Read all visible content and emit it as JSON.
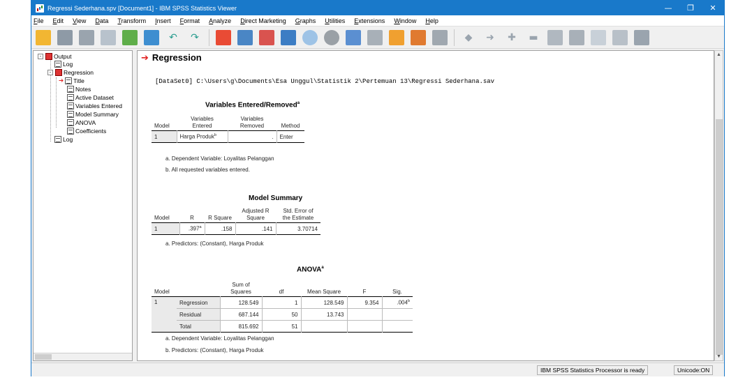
{
  "window": {
    "title": "Regressi Sederhana.spv [Document1] - IBM SPSS Statistics Viewer",
    "min": "—",
    "max": "❐",
    "close": "✕"
  },
  "menu": [
    "File",
    "Edit",
    "View",
    "Data",
    "Transform",
    "Insert",
    "Format",
    "Analyze",
    "Direct Marketing",
    "Graphs",
    "Utilities",
    "Extensions",
    "Window",
    "Help"
  ],
  "toolbar": {
    "icons": [
      "open-icon",
      "save-icon",
      "print-icon",
      "print-preview-icon",
      "export-icon",
      "recall-dialog-icon",
      "undo-icon",
      "redo-icon",
      "goto-data-icon",
      "goto-case-icon",
      "goto-variable-icon",
      "variables-icon",
      "run-descriptives-icon",
      "use-variable-sets-icon",
      "show-all-variables-icon",
      "select-cases-icon",
      "value-labels-icon",
      "designate-window-icon",
      "promote-icon",
      "demote-icon",
      "expand-icon",
      "collapse-icon",
      "show-icon",
      "hide-icon",
      "insert-heading-icon",
      "insert-title-icon",
      "insert-text-icon"
    ]
  },
  "tree": {
    "items": [
      "Output",
      "Log",
      "Regression",
      "Title",
      "Notes",
      "Active Dataset",
      "Variables Entered",
      "Model Summary",
      "ANOVA",
      "Coefficients",
      "Log"
    ]
  },
  "output": {
    "section_title": "Regression",
    "dataset_line": "[DataSet0] C:\\Users\\g\\Documents\\Esa Unggul\\Statistik 2\\Pertemuan 13\\Regressi Sederhana.sav",
    "ver": {
      "title": "Variables Entered/Removed",
      "title_sup": "a",
      "h_model": "Model",
      "h_entered_1": "Variables",
      "h_entered_2": "Entered",
      "h_removed_1": "Variables",
      "h_removed_2": "Removed",
      "h_method": "Method",
      "row_model": "1",
      "row_entered": "Harga Produk",
      "row_entered_sup": "b",
      "row_removed": ".",
      "row_method": "Enter",
      "foot_a": "a. Dependent Variable: Loyalitas Pelanggan",
      "foot_b": "b. All requested variables entered."
    },
    "ms": {
      "title": "Model Summary",
      "h_model": "Model",
      "h_r": "R",
      "h_rsq": "R Square",
      "h_adj_1": "Adjusted R",
      "h_adj_2": "Square",
      "h_se_1": "Std. Error of",
      "h_se_2": "the Estimate",
      "row_model": "1",
      "row_r": ".397",
      "row_r_sup": "a",
      "row_rsq": ".158",
      "row_adj": ".141",
      "row_se": "3.70714",
      "foot_a": "a. Predictors: (Constant), Harga Produk"
    },
    "anova": {
      "title": "ANOVA",
      "title_sup": "a",
      "h_model": "Model",
      "h_ss_1": "Sum of",
      "h_ss_2": "Squares",
      "h_df": "df",
      "h_ms": "Mean Square",
      "h_f": "F",
      "h_sig": "Sig.",
      "model": "1",
      "rows": [
        {
          "label": "Regression",
          "ss": "128.549",
          "df": "1",
          "ms": "128.549",
          "f": "9.354",
          "sig": ".004",
          "sig_sup": "b"
        },
        {
          "label": "Residual",
          "ss": "687.144",
          "df": "50",
          "ms": "13.743",
          "f": "",
          "sig": "",
          "sig_sup": ""
        },
        {
          "label": "Total",
          "ss": "815.692",
          "df": "51",
          "ms": "",
          "f": "",
          "sig": "",
          "sig_sup": ""
        }
      ],
      "foot_a": "a. Dependent Variable: Loyalitas Pelanggan",
      "foot_b": "b. Predictors: (Constant), Harga Produk"
    }
  },
  "status": {
    "processor": "IBM SPSS Statistics Processor is ready",
    "unicode": "Unicode:ON"
  }
}
